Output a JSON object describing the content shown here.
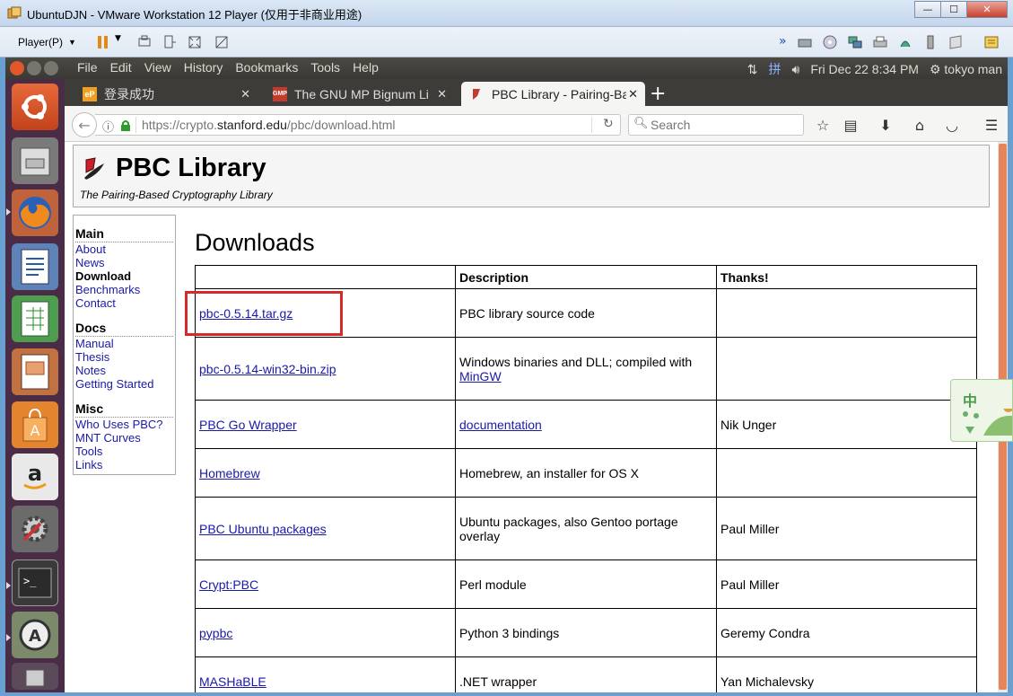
{
  "vmware": {
    "title": "UbuntuDJN - VMware Workstation 12 Player (仅用于非商业用途)",
    "player_menu": "Player(P)",
    "win_minimize": "—",
    "win_maximize": "☐",
    "win_close": "✕"
  },
  "ubuntu_panel": {
    "menus": [
      "File",
      "Edit",
      "View",
      "History",
      "Bookmarks",
      "Tools",
      "Help"
    ],
    "ime": "拼",
    "datetime": "Fri Dec 22  8:34 PM",
    "user": "tokyo man"
  },
  "tabs": [
    {
      "label": "登录成功",
      "favicon": "eP",
      "color": "#f0a020"
    },
    {
      "label": "The GNU MP Bignum Library",
      "favicon": "GMP",
      "color": "#c23b2c"
    },
    {
      "label": "PBC Library - Pairing-Based Cryptography",
      "favicon": "",
      "color": "#c23b2c"
    }
  ],
  "tab_close": "✕",
  "new_tab": "+",
  "url": {
    "scheme_prefix": "https://crypto.",
    "domain": "stanford.edu",
    "path": "/pbc/download.html"
  },
  "search": {
    "placeholder": "Search"
  },
  "page": {
    "title": "PBC Library",
    "subtitle": "The Pairing-Based Cryptography Library",
    "heading": "Downloads",
    "nav": {
      "main_heading": "Main",
      "main_items": [
        "About",
        "News",
        "Download",
        "Benchmarks",
        "Contact"
      ],
      "docs_heading": "Docs",
      "docs_items": [
        "Manual",
        "Thesis",
        "Notes",
        "Getting Started"
      ],
      "misc_heading": "Misc",
      "misc_items": [
        "Who Uses PBC?",
        "MNT Curves",
        "Tools",
        "Links"
      ]
    },
    "table": {
      "headers": [
        "",
        "Description",
        "Thanks!"
      ],
      "rows": [
        {
          "file": "pbc-0.5.14.tar.gz",
          "desc": "PBC library source code",
          "desc_link": "",
          "thanks": ""
        },
        {
          "file": "pbc-0.5.14-win32-bin.zip",
          "desc": "Windows binaries and DLL; compiled with",
          "desc_link": "MinGW",
          "thanks": ""
        },
        {
          "file": "PBC Go Wrapper",
          "desc": "",
          "desc_link": "documentation",
          "thanks": "Nik Unger"
        },
        {
          "file": "Homebrew",
          "desc": "Homebrew, an installer for OS X",
          "desc_link": "",
          "thanks": ""
        },
        {
          "file": "PBC Ubuntu packages",
          "desc": "Ubuntu packages, also Gentoo portage overlay",
          "desc_link": "",
          "thanks": "Paul Miller"
        },
        {
          "file": "Crypt:PBC",
          "desc": "Perl module",
          "desc_link": "",
          "thanks": "Paul Miller"
        },
        {
          "file": "pypbc",
          "desc": "Python 3 bindings",
          "desc_link": "",
          "thanks": "Geremy Condra"
        },
        {
          "file": "MASHaBLE",
          "desc": ".NET wrapper",
          "desc_link": "",
          "thanks": "Yan Michalevsky"
        }
      ]
    }
  },
  "ime_widget": {
    "label": "中"
  }
}
